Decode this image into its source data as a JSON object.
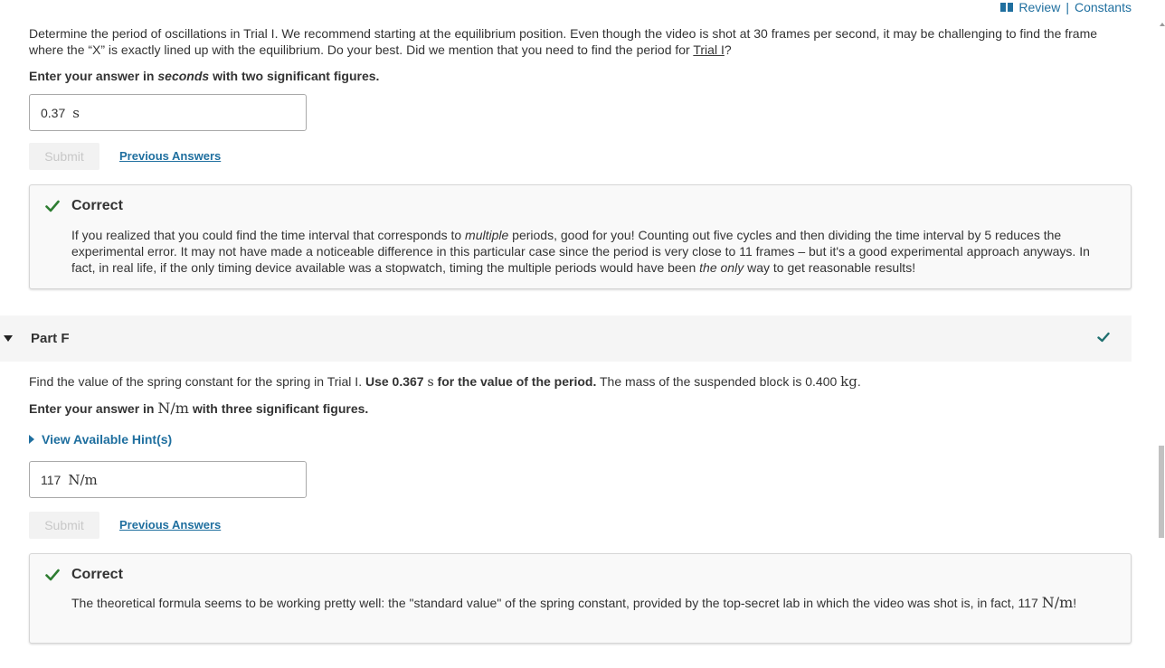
{
  "topbar": {
    "review": "Review",
    "separator": "|",
    "constants": "Constants"
  },
  "partE": {
    "question": {
      "t1": "Determine the period of oscillations in Trial I. We recommend starting at the equilibrium position. Even though the video is shot at 30 frames per second, it may be challenging to find the frame where the “X” is exactly lined up with the equilibrium. Do your best. Did we mention that you need to find the period for ",
      "trial_link": "Trial I",
      "t2": "?"
    },
    "instruction": {
      "t1": "Enter your answer in ",
      "em": "seconds",
      "t2": " with two significant figures."
    },
    "answer_value": "0.37",
    "answer_unit": "s",
    "submit_label": "Submit",
    "previous_label": "Previous Answers",
    "feedback": {
      "title": "Correct",
      "p1": "If you realized that you could find the time interval that corresponds to ",
      "em1": "multiple",
      "p2": " periods, good for you! Counting out five cycles and then dividing the time interval by 5 reduces the experimental error. It may not have made a noticeable difference in this particular case since the period is very close to 11 frames – but it's a good experimental approach anyways. In fact, in real life, if the only timing device available was a stopwatch, timing the multiple periods would have been ",
      "em2": "the only",
      "p3": " way to get reasonable results!"
    }
  },
  "partF": {
    "header": "Part F",
    "question": {
      "t1": "Find the value of the spring constant for the spring in Trial I. ",
      "b1": "Use 0.367 ",
      "unit_s": "s",
      "b2": " for the value of the period.",
      "t2": " The mass of the suspended block is 0.400 ",
      "unit_kg": "kg",
      "t3": "."
    },
    "instruction": {
      "t1": "Enter your answer in ",
      "unit": "N/m",
      "t2": " with three significant figures."
    },
    "hints_label": "View Available Hint(s)",
    "answer_value": "117",
    "answer_unit": "N/m",
    "submit_label": "Submit",
    "previous_label": "Previous Answers",
    "feedback": {
      "title": "Correct",
      "p1": "The theoretical formula seems to be working pretty well: the \"standard value\" of the spring constant, provided by the top-secret lab in which the video was shot is, in fact, 117 ",
      "unit": "N/m",
      "p2": "!"
    }
  },
  "colors": {
    "link": "#1f6f9f",
    "check": "#2e7d32",
    "panel": "#f9f9f9"
  }
}
